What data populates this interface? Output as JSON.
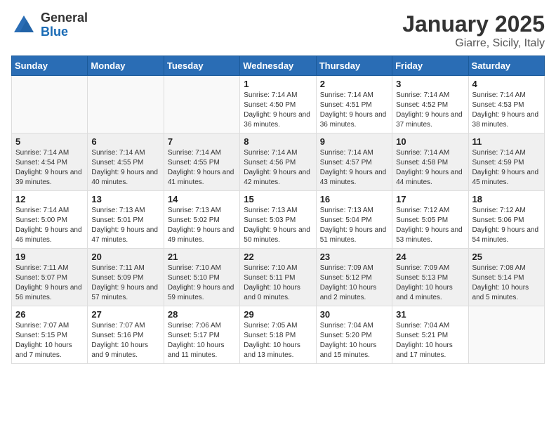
{
  "header": {
    "logo_general": "General",
    "logo_blue": "Blue",
    "title": "January 2025",
    "subtitle": "Giarre, Sicily, Italy"
  },
  "weekdays": [
    "Sunday",
    "Monday",
    "Tuesday",
    "Wednesday",
    "Thursday",
    "Friday",
    "Saturday"
  ],
  "weeks": [
    {
      "shaded": false,
      "days": [
        {
          "number": "",
          "info": ""
        },
        {
          "number": "",
          "info": ""
        },
        {
          "number": "",
          "info": ""
        },
        {
          "number": "1",
          "info": "Sunrise: 7:14 AM\nSunset: 4:50 PM\nDaylight: 9 hours and 36 minutes."
        },
        {
          "number": "2",
          "info": "Sunrise: 7:14 AM\nSunset: 4:51 PM\nDaylight: 9 hours and 36 minutes."
        },
        {
          "number": "3",
          "info": "Sunrise: 7:14 AM\nSunset: 4:52 PM\nDaylight: 9 hours and 37 minutes."
        },
        {
          "number": "4",
          "info": "Sunrise: 7:14 AM\nSunset: 4:53 PM\nDaylight: 9 hours and 38 minutes."
        }
      ]
    },
    {
      "shaded": true,
      "days": [
        {
          "number": "5",
          "info": "Sunrise: 7:14 AM\nSunset: 4:54 PM\nDaylight: 9 hours and 39 minutes."
        },
        {
          "number": "6",
          "info": "Sunrise: 7:14 AM\nSunset: 4:55 PM\nDaylight: 9 hours and 40 minutes."
        },
        {
          "number": "7",
          "info": "Sunrise: 7:14 AM\nSunset: 4:55 PM\nDaylight: 9 hours and 41 minutes."
        },
        {
          "number": "8",
          "info": "Sunrise: 7:14 AM\nSunset: 4:56 PM\nDaylight: 9 hours and 42 minutes."
        },
        {
          "number": "9",
          "info": "Sunrise: 7:14 AM\nSunset: 4:57 PM\nDaylight: 9 hours and 43 minutes."
        },
        {
          "number": "10",
          "info": "Sunrise: 7:14 AM\nSunset: 4:58 PM\nDaylight: 9 hours and 44 minutes."
        },
        {
          "number": "11",
          "info": "Sunrise: 7:14 AM\nSunset: 4:59 PM\nDaylight: 9 hours and 45 minutes."
        }
      ]
    },
    {
      "shaded": false,
      "days": [
        {
          "number": "12",
          "info": "Sunrise: 7:14 AM\nSunset: 5:00 PM\nDaylight: 9 hours and 46 minutes."
        },
        {
          "number": "13",
          "info": "Sunrise: 7:13 AM\nSunset: 5:01 PM\nDaylight: 9 hours and 47 minutes."
        },
        {
          "number": "14",
          "info": "Sunrise: 7:13 AM\nSunset: 5:02 PM\nDaylight: 9 hours and 49 minutes."
        },
        {
          "number": "15",
          "info": "Sunrise: 7:13 AM\nSunset: 5:03 PM\nDaylight: 9 hours and 50 minutes."
        },
        {
          "number": "16",
          "info": "Sunrise: 7:13 AM\nSunset: 5:04 PM\nDaylight: 9 hours and 51 minutes."
        },
        {
          "number": "17",
          "info": "Sunrise: 7:12 AM\nSunset: 5:05 PM\nDaylight: 9 hours and 53 minutes."
        },
        {
          "number": "18",
          "info": "Sunrise: 7:12 AM\nSunset: 5:06 PM\nDaylight: 9 hours and 54 minutes."
        }
      ]
    },
    {
      "shaded": true,
      "days": [
        {
          "number": "19",
          "info": "Sunrise: 7:11 AM\nSunset: 5:07 PM\nDaylight: 9 hours and 56 minutes."
        },
        {
          "number": "20",
          "info": "Sunrise: 7:11 AM\nSunset: 5:09 PM\nDaylight: 9 hours and 57 minutes."
        },
        {
          "number": "21",
          "info": "Sunrise: 7:10 AM\nSunset: 5:10 PM\nDaylight: 9 hours and 59 minutes."
        },
        {
          "number": "22",
          "info": "Sunrise: 7:10 AM\nSunset: 5:11 PM\nDaylight: 10 hours and 0 minutes."
        },
        {
          "number": "23",
          "info": "Sunrise: 7:09 AM\nSunset: 5:12 PM\nDaylight: 10 hours and 2 minutes."
        },
        {
          "number": "24",
          "info": "Sunrise: 7:09 AM\nSunset: 5:13 PM\nDaylight: 10 hours and 4 minutes."
        },
        {
          "number": "25",
          "info": "Sunrise: 7:08 AM\nSunset: 5:14 PM\nDaylight: 10 hours and 5 minutes."
        }
      ]
    },
    {
      "shaded": false,
      "days": [
        {
          "number": "26",
          "info": "Sunrise: 7:07 AM\nSunset: 5:15 PM\nDaylight: 10 hours and 7 minutes."
        },
        {
          "number": "27",
          "info": "Sunrise: 7:07 AM\nSunset: 5:16 PM\nDaylight: 10 hours and 9 minutes."
        },
        {
          "number": "28",
          "info": "Sunrise: 7:06 AM\nSunset: 5:17 PM\nDaylight: 10 hours and 11 minutes."
        },
        {
          "number": "29",
          "info": "Sunrise: 7:05 AM\nSunset: 5:18 PM\nDaylight: 10 hours and 13 minutes."
        },
        {
          "number": "30",
          "info": "Sunrise: 7:04 AM\nSunset: 5:20 PM\nDaylight: 10 hours and 15 minutes."
        },
        {
          "number": "31",
          "info": "Sunrise: 7:04 AM\nSunset: 5:21 PM\nDaylight: 10 hours and 17 minutes."
        },
        {
          "number": "",
          "info": ""
        }
      ]
    }
  ]
}
